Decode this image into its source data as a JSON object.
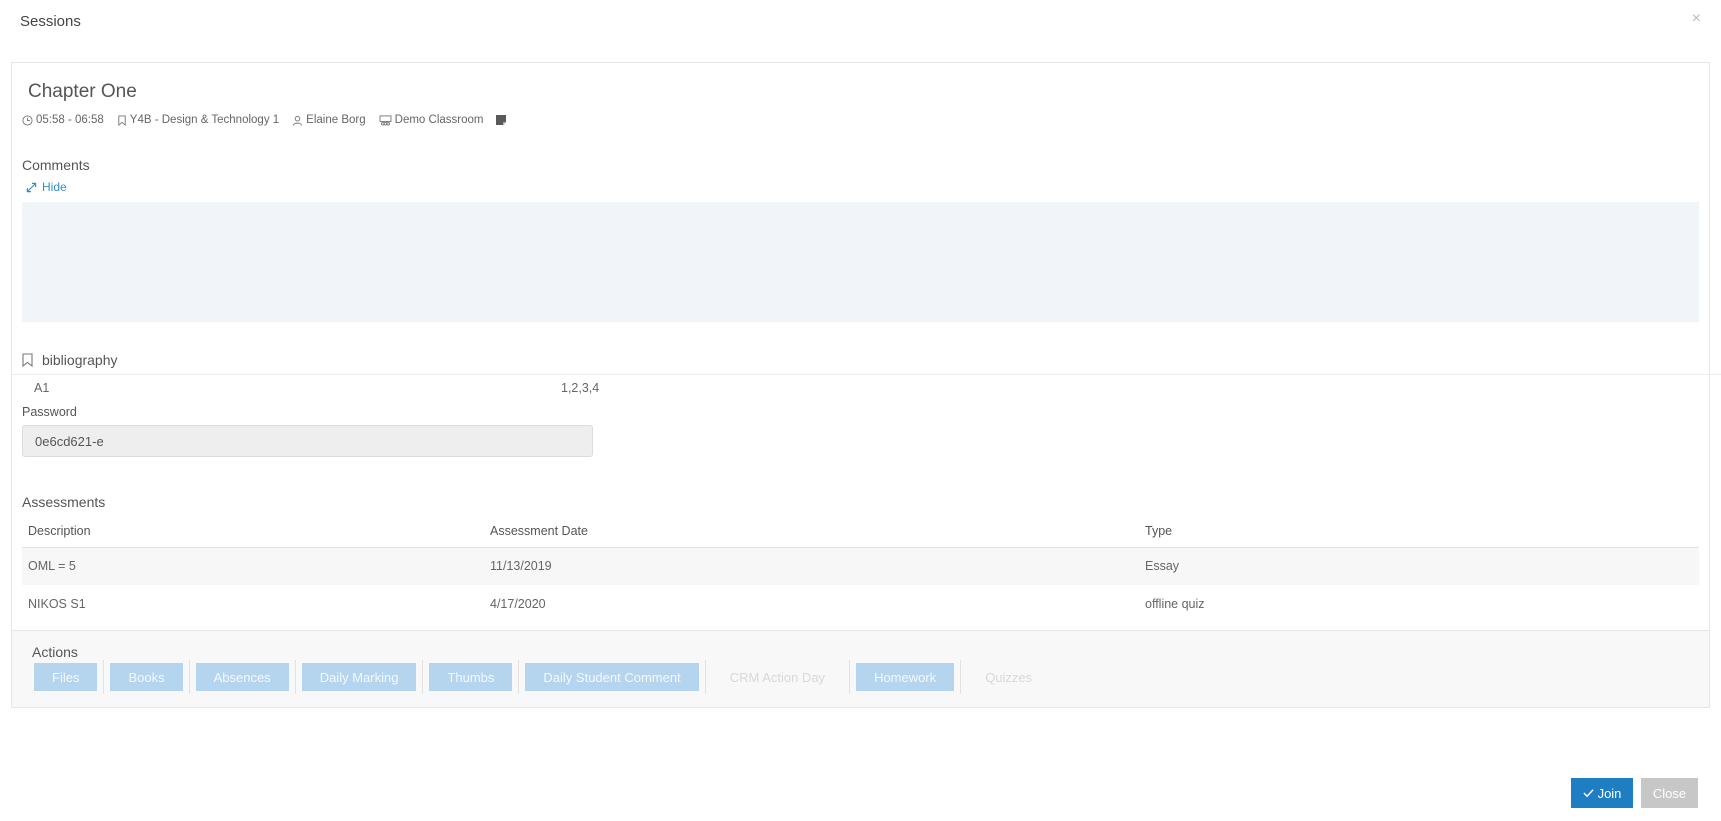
{
  "modal": {
    "title": "Sessions",
    "close_glyph": "×"
  },
  "session": {
    "title": "Chapter One",
    "time": "05:58 - 06:58",
    "course": "Y4B - Design & Technology 1",
    "teacher": "Elaine Borg",
    "room": "Demo Classroom"
  },
  "comments": {
    "label": "Comments",
    "hide_label": "Hide"
  },
  "bibliography": {
    "label": "bibliography",
    "items": [
      {
        "name": "A1",
        "value": "1,2,3,4"
      }
    ]
  },
  "password": {
    "label": "Password",
    "value": "0e6cd621-e"
  },
  "assessments": {
    "label": "Assessments",
    "columns": [
      "Description",
      "Assessment Date",
      "Type"
    ],
    "rows": [
      [
        "OML = 5",
        "11/13/2019",
        "Essay"
      ],
      [
        "NIKOS S1",
        "4/17/2020",
        "offline quiz"
      ]
    ]
  },
  "actions": {
    "label": "Actions",
    "buttons": [
      {
        "label": "Files",
        "enabled": true
      },
      {
        "label": "Books",
        "enabled": true
      },
      {
        "label": "Absences",
        "enabled": true
      },
      {
        "label": "Daily Marking",
        "enabled": true
      },
      {
        "label": "Thumbs",
        "enabled": true
      },
      {
        "label": "Daily Student Comment",
        "enabled": true
      },
      {
        "label": "CRM Action Day",
        "enabled": false
      },
      {
        "label": "Homework",
        "enabled": true
      },
      {
        "label": "Quizzes",
        "enabled": false
      }
    ]
  },
  "footer": {
    "join_label": "Join",
    "close_label": "Close"
  },
  "colors": {
    "primary": "#1f7ec2",
    "link": "#3c8dbc",
    "action_bg": "#b5d5ee",
    "close_bg": "#c7c7c7"
  },
  "icons": [
    "clock-icon",
    "bookmark-icon",
    "user-icon",
    "classroom-icon",
    "note-icon",
    "expand-icon",
    "check-icon"
  ]
}
